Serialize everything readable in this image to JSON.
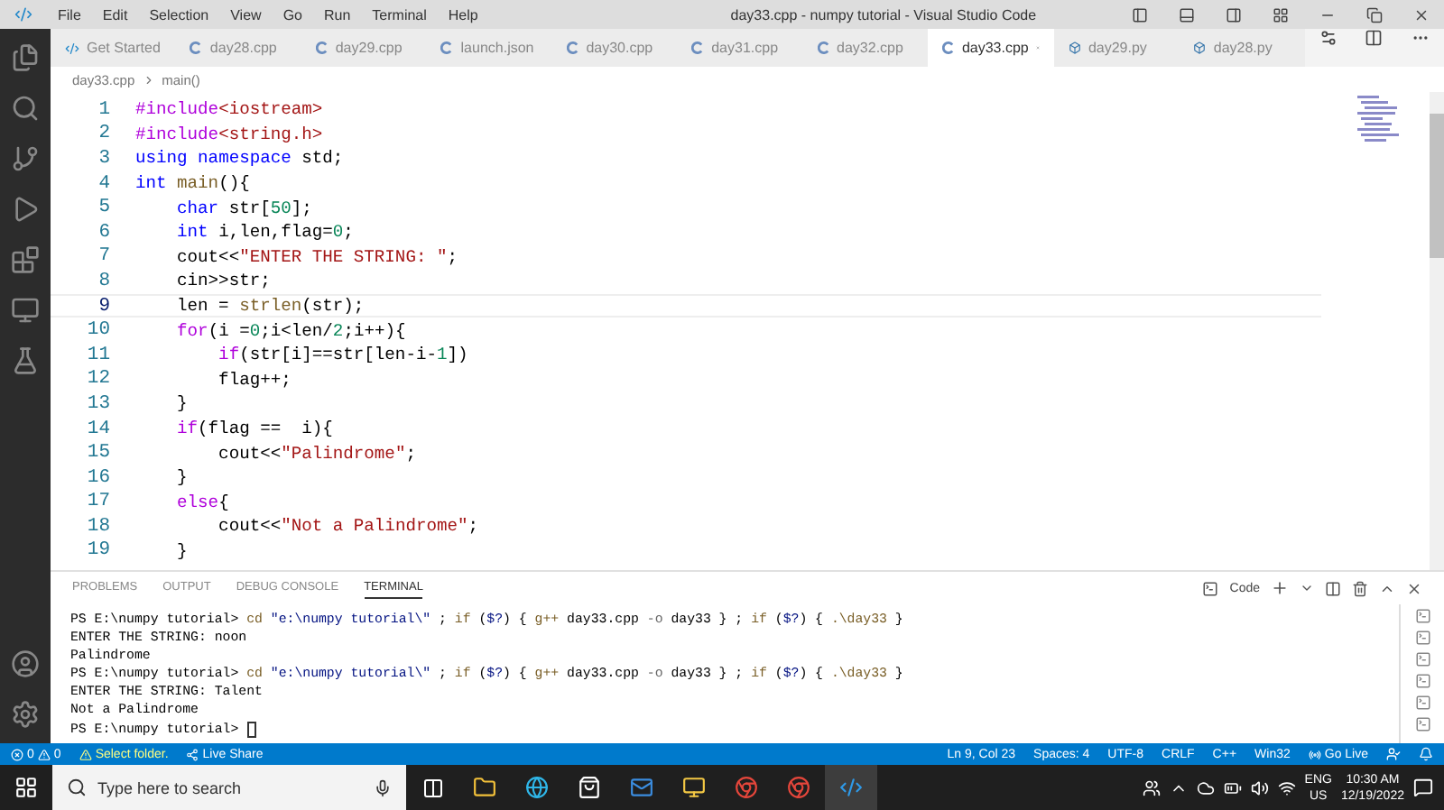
{
  "title_bar": {
    "menu": [
      "File",
      "Edit",
      "Selection",
      "View",
      "Go",
      "Run",
      "Terminal",
      "Help"
    ],
    "title": "day33.cpp - numpy tutorial - Visual Studio Code"
  },
  "tabs": [
    {
      "label": "Get Started",
      "kind": "welcome",
      "selected": false
    },
    {
      "label": "day28.cpp",
      "kind": "cpp",
      "selected": false
    },
    {
      "label": "day29.cpp",
      "kind": "cpp",
      "selected": false
    },
    {
      "label": "launch.json",
      "kind": "cpp",
      "selected": false
    },
    {
      "label": "day30.cpp",
      "kind": "cpp",
      "selected": false
    },
    {
      "label": "day31.cpp",
      "kind": "cpp",
      "selected": false
    },
    {
      "label": "day32.cpp",
      "kind": "cpp",
      "selected": false
    },
    {
      "label": "day33.cpp",
      "kind": "cpp",
      "selected": true
    },
    {
      "label": "day29.py",
      "kind": "py",
      "selected": false
    },
    {
      "label": "day28.py",
      "kind": "py",
      "selected": false
    }
  ],
  "breadcrumb": [
    "day33.cpp",
    "main()"
  ],
  "editor": {
    "lines": [
      {
        "number": "1",
        "current": false,
        "tokens": [
          {
            "kind": "include",
            "text": "#include"
          },
          {
            "kind": "string",
            "text": "<iostream>"
          }
        ]
      },
      {
        "number": "2",
        "current": false,
        "tokens": [
          {
            "kind": "include",
            "text": "#include"
          },
          {
            "kind": "string",
            "text": "<string.h>"
          }
        ]
      },
      {
        "number": "3",
        "current": false,
        "tokens": [
          {
            "kind": "keyword",
            "text": "using"
          },
          {
            "kind": "keyword",
            "text": " namespace"
          },
          {
            "kind": "plain",
            "text": " std;"
          }
        ]
      },
      {
        "number": "4",
        "current": false,
        "tokens": [
          {
            "kind": "keyword",
            "text": "int"
          },
          {
            "kind": "function",
            "text": " main"
          },
          {
            "kind": "plain",
            "text": "(){"
          }
        ]
      },
      {
        "number": "5",
        "current": false,
        "tokens": [
          {
            "kind": "keyword",
            "text": "    char"
          },
          {
            "kind": "plain",
            "text": " str["
          },
          {
            "kind": "number",
            "text": "50"
          },
          {
            "kind": "plain",
            "text": "];"
          }
        ]
      },
      {
        "number": "6",
        "current": false,
        "tokens": [
          {
            "kind": "keyword",
            "text": "    int"
          },
          {
            "kind": "plain",
            "text": " i,len,flag="
          },
          {
            "kind": "number",
            "text": "0"
          },
          {
            "kind": "plain",
            "text": ";"
          }
        ]
      },
      {
        "number": "7",
        "current": false,
        "tokens": [
          {
            "kind": "plain",
            "text": "    cout<<"
          },
          {
            "kind": "string",
            "text": "\"ENTER THE STRING: \""
          },
          {
            "kind": "plain",
            "text": ";"
          }
        ]
      },
      {
        "number": "8",
        "current": false,
        "tokens": [
          {
            "kind": "plain",
            "text": "    cin>>str;"
          }
        ]
      },
      {
        "number": "9",
        "current": true,
        "tokens": [
          {
            "kind": "plain",
            "text": "    len = "
          },
          {
            "kind": "function",
            "text": "strlen"
          },
          {
            "kind": "plain",
            "text": "(str);"
          }
        ]
      },
      {
        "number": "10",
        "current": false,
        "tokens": [
          {
            "kind": "control",
            "text": "    for"
          },
          {
            "kind": "plain",
            "text": "(i ="
          },
          {
            "kind": "number",
            "text": "0"
          },
          {
            "kind": "plain",
            "text": ";i<len/"
          },
          {
            "kind": "number",
            "text": "2"
          },
          {
            "kind": "plain",
            "text": ";i++){"
          }
        ]
      },
      {
        "number": "11",
        "current": false,
        "tokens": [
          {
            "kind": "control",
            "text": "        if"
          },
          {
            "kind": "plain",
            "text": "(str[i]==str[len-i-"
          },
          {
            "kind": "number",
            "text": "1"
          },
          {
            "kind": "plain",
            "text": "])"
          }
        ]
      },
      {
        "number": "12",
        "current": false,
        "tokens": [
          {
            "kind": "plain",
            "text": "        flag++;"
          }
        ]
      },
      {
        "number": "13",
        "current": false,
        "tokens": [
          {
            "kind": "plain",
            "text": "    }"
          }
        ]
      },
      {
        "number": "14",
        "current": false,
        "tokens": [
          {
            "kind": "control",
            "text": "    if"
          },
          {
            "kind": "plain",
            "text": "(flag ==  i){"
          }
        ]
      },
      {
        "number": "15",
        "current": false,
        "tokens": [
          {
            "kind": "plain",
            "text": "        cout<<"
          },
          {
            "kind": "string",
            "text": "\"Palindrome\""
          },
          {
            "kind": "plain",
            "text": ";"
          }
        ]
      },
      {
        "number": "16",
        "current": false,
        "tokens": [
          {
            "kind": "plain",
            "text": "    }"
          }
        ]
      },
      {
        "number": "17",
        "current": false,
        "tokens": [
          {
            "kind": "control",
            "text": "    else"
          },
          {
            "kind": "plain",
            "text": "{"
          }
        ]
      },
      {
        "number": "18",
        "current": false,
        "tokens": [
          {
            "kind": "plain",
            "text": "        cout<<"
          },
          {
            "kind": "string",
            "text": "\"Not a Palindrome\""
          },
          {
            "kind": "plain",
            "text": ";"
          }
        ]
      },
      {
        "number": "19",
        "current": false,
        "tokens": [
          {
            "kind": "plain",
            "text": "    }"
          }
        ]
      }
    ]
  },
  "panel": {
    "tabs": [
      {
        "label": "PROBLEMS",
        "selected": false
      },
      {
        "label": "OUTPUT",
        "selected": false
      },
      {
        "label": "DEBUG CONSOLE",
        "selected": false
      },
      {
        "label": "TERMINAL",
        "selected": true
      }
    ],
    "terminal_name": "Code",
    "lines": [
      {
        "cursor": false,
        "tokens": [
          {
            "kind": "plain",
            "text": "PS E:\\numpy tutorial> "
          },
          {
            "kind": "command",
            "text": "cd "
          },
          {
            "kind": "string",
            "text": "\"e:\\numpy tutorial\\\""
          },
          {
            "kind": "plain",
            "text": " ; "
          },
          {
            "kind": "command",
            "text": "if"
          },
          {
            "kind": "plain",
            "text": " ("
          },
          {
            "kind": "variable",
            "text": "$?"
          },
          {
            "kind": "plain",
            "text": ") { "
          },
          {
            "kind": "command",
            "text": "g++"
          },
          {
            "kind": "plain",
            "text": " day33.cpp "
          },
          {
            "kind": "param",
            "text": "-o"
          },
          {
            "kind": "plain",
            "text": " day33 } ; "
          },
          {
            "kind": "command",
            "text": "if"
          },
          {
            "kind": "plain",
            "text": " ("
          },
          {
            "kind": "variable",
            "text": "$?"
          },
          {
            "kind": "plain",
            "text": ") { "
          },
          {
            "kind": "command",
            "text": ".\\day33"
          },
          {
            "kind": "plain",
            "text": " }"
          }
        ]
      },
      {
        "cursor": false,
        "tokens": [
          {
            "kind": "plain",
            "text": "ENTER THE STRING: noon"
          }
        ]
      },
      {
        "cursor": false,
        "tokens": [
          {
            "kind": "plain",
            "text": "Palindrome"
          }
        ]
      },
      {
        "cursor": false,
        "tokens": [
          {
            "kind": "plain",
            "text": "PS E:\\numpy tutorial> "
          },
          {
            "kind": "command",
            "text": "cd "
          },
          {
            "kind": "string",
            "text": "\"e:\\numpy tutorial\\\""
          },
          {
            "kind": "plain",
            "text": " ; "
          },
          {
            "kind": "command",
            "text": "if"
          },
          {
            "kind": "plain",
            "text": " ("
          },
          {
            "kind": "variable",
            "text": "$?"
          },
          {
            "kind": "plain",
            "text": ") { "
          },
          {
            "kind": "command",
            "text": "g++"
          },
          {
            "kind": "plain",
            "text": " day33.cpp "
          },
          {
            "kind": "param",
            "text": "-o"
          },
          {
            "kind": "plain",
            "text": " day33 } ; "
          },
          {
            "kind": "command",
            "text": "if"
          },
          {
            "kind": "plain",
            "text": " ("
          },
          {
            "kind": "variable",
            "text": "$?"
          },
          {
            "kind": "plain",
            "text": ") { "
          },
          {
            "kind": "command",
            "text": ".\\day33"
          },
          {
            "kind": "plain",
            "text": " }"
          }
        ]
      },
      {
        "cursor": false,
        "tokens": [
          {
            "kind": "plain",
            "text": "ENTER THE STRING: Talent"
          }
        ]
      },
      {
        "cursor": false,
        "tokens": [
          {
            "kind": "plain",
            "text": "Not a Palindrome"
          }
        ]
      },
      {
        "cursor": true,
        "tokens": [
          {
            "kind": "plain",
            "text": "PS E:\\numpy tutorial> "
          }
        ]
      }
    ]
  },
  "status_bar": {
    "errors": "0",
    "warnings": "0",
    "folder": "Select folder.",
    "live_share": "Live Share",
    "items": [
      "Ln 9, Col 23",
      "Spaces: 4",
      "UTF-8",
      "CRLF",
      "C++",
      "Win32"
    ],
    "go_live": "Go Live"
  },
  "taskbar": {
    "search_placeholder": "Type here to search",
    "language": "ENG",
    "region": "US",
    "time": "10:30 AM",
    "date": "12/19/2022"
  }
}
